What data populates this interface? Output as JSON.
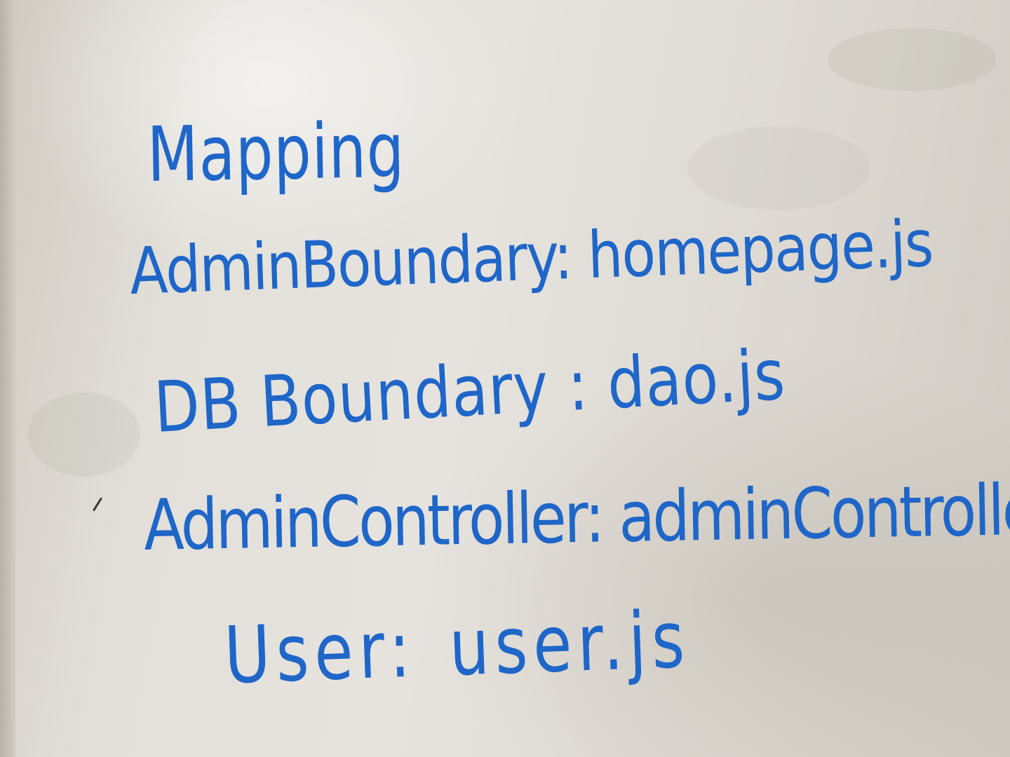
{
  "whiteboard": {
    "title": "Mapping",
    "mappings": [
      {
        "name": "AdminBoundary",
        "separator": ":",
        "file": "homepage.js"
      },
      {
        "name": "DB Boundary",
        "separator": ":",
        "file": "dao.js"
      },
      {
        "name": "AdminController",
        "separator": ":",
        "file": "adminController.js"
      },
      {
        "name": "User",
        "separator": ":",
        "file": "user.js"
      }
    ],
    "ink_color": "#1f66c9"
  }
}
